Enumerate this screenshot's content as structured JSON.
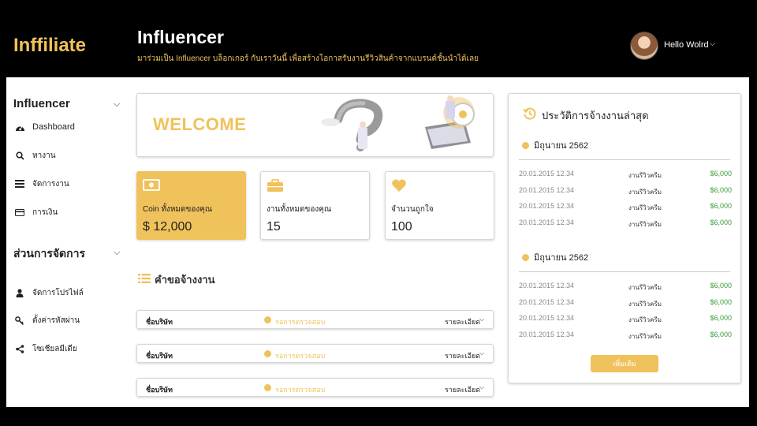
{
  "brand": {
    "logo": "Inffiliate",
    "accent": "#f0c25c"
  },
  "header": {
    "title": "Influencer",
    "subtitle": "มาร่วมเป็น Influencer บล็อกเกอร์ กับเราวันนี้ เพื่อสร้างโอกาสรับงานรีวิวสินค้าจากแบรนด์ชั้นนำได้เลย",
    "user_name": "Hello Wolrd"
  },
  "sidebar": {
    "section1": {
      "title": "Influencer",
      "items": [
        {
          "label": "Dashboard",
          "icon": "dashboard-icon"
        },
        {
          "label": "หางาน",
          "icon": "search-icon"
        },
        {
          "label": "จัดการงาน",
          "icon": "list-icon"
        },
        {
          "label": "การเงิน",
          "icon": "credit-card-icon"
        }
      ]
    },
    "section2": {
      "title": "ส่วนการจัดการ",
      "items": [
        {
          "label": "จัดการโปรไฟล์",
          "icon": "user-icon"
        },
        {
          "label": "ตั้งค่ารหัสผ่าน",
          "icon": "key-icon"
        },
        {
          "label": "โซเชียลมีเดีย",
          "icon": "share-icon"
        }
      ]
    }
  },
  "welcome": {
    "text": "WELCOME"
  },
  "stats": [
    {
      "label": "Coin ทั้งหมดของคุณ",
      "value": "$ 12,000",
      "icon": "money-icon"
    },
    {
      "label": "งานทั้งหมดของคุณ",
      "value": "15",
      "icon": "briefcase-icon"
    },
    {
      "label": "จำนวนถูกใจ",
      "value": "100",
      "icon": "heart-icon"
    }
  ],
  "jobs": {
    "title": "คำขอจ้างงาน",
    "rows": [
      {
        "company": "ชื่อบริษัท",
        "status": "รอการตรวจสอบ",
        "detail": "รายละเอียด"
      },
      {
        "company": "ชื่อบริษัท",
        "status": "รอการตรวจสอบ",
        "detail": "รายละเอียด"
      },
      {
        "company": "ชื่อบริษัท",
        "status": "รอการตรวจสอบ",
        "detail": "รายละเอียด"
      }
    ]
  },
  "history": {
    "title": "ประวัติการจ้างงานล่าสุด",
    "groups": [
      {
        "month": "มิถุนายน 2562",
        "rows": [
          {
            "date": "20.01.2015 12.34",
            "type": "งานรีวิวครีม",
            "amount": "$6,000"
          },
          {
            "date": "20.01.2015 12.34",
            "type": "งานรีวิวครีม",
            "amount": "$6,000"
          },
          {
            "date": "20.01.2015 12.34",
            "type": "งานรีวิวครีม",
            "amount": "$6,000"
          },
          {
            "date": "20.01.2015 12.34",
            "type": "งานรีวิวครีม",
            "amount": "$6,000"
          }
        ]
      },
      {
        "month": "มิถุนายน 2562",
        "rows": [
          {
            "date": "20.01.2015 12.34",
            "type": "งานรีวิวครีม",
            "amount": "$6,000"
          },
          {
            "date": "20.01.2015 12.34",
            "type": "งานรีวิวครีม",
            "amount": "$6,000"
          },
          {
            "date": "20.01.2015 12.34",
            "type": "งานรีวิวครีม",
            "amount": "$6,000"
          },
          {
            "date": "20.01.2015 12.34",
            "type": "งานรีวิวครีม",
            "amount": "$6,000"
          }
        ]
      }
    ],
    "more_label": "เพิ่มเติม"
  }
}
